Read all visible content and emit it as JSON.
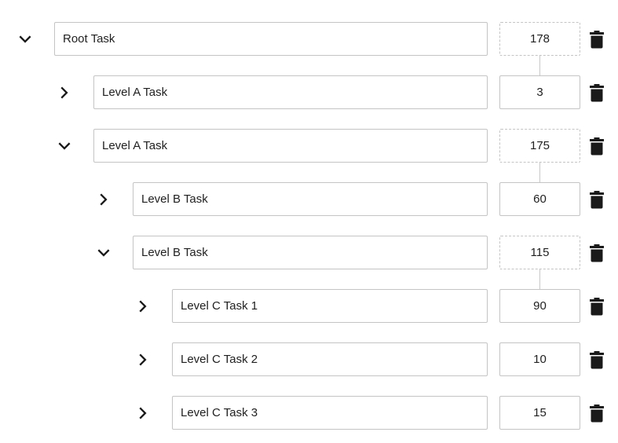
{
  "tasks": [
    {
      "name": "Root Task",
      "value": "178",
      "level": 0,
      "expanded": true,
      "computed": true
    },
    {
      "name": "Level A Task",
      "value": "3",
      "level": 1,
      "expanded": false,
      "computed": false
    },
    {
      "name": "Level A Task",
      "value": "175",
      "level": 1,
      "expanded": true,
      "computed": true
    },
    {
      "name": "Level B Task",
      "value": "60",
      "level": 2,
      "expanded": false,
      "computed": false
    },
    {
      "name": "Level B Task",
      "value": "115",
      "level": 2,
      "expanded": true,
      "computed": true
    },
    {
      "name": "Level C Task 1",
      "value": "90",
      "level": 3,
      "expanded": false,
      "computed": false
    },
    {
      "name": "Level C Task 2",
      "value": "10",
      "level": 3,
      "expanded": false,
      "computed": false
    },
    {
      "name": "Level C Task 3",
      "value": "15",
      "level": 3,
      "expanded": false,
      "computed": false
    }
  ],
  "icons": {
    "expanded": "chevron-down-icon",
    "collapsed": "chevron-right-icon",
    "delete": "trash-icon"
  },
  "colors": {
    "border": "#c4c4c4",
    "icon": "#1a1a1a",
    "connector": "#c8c8c8"
  }
}
